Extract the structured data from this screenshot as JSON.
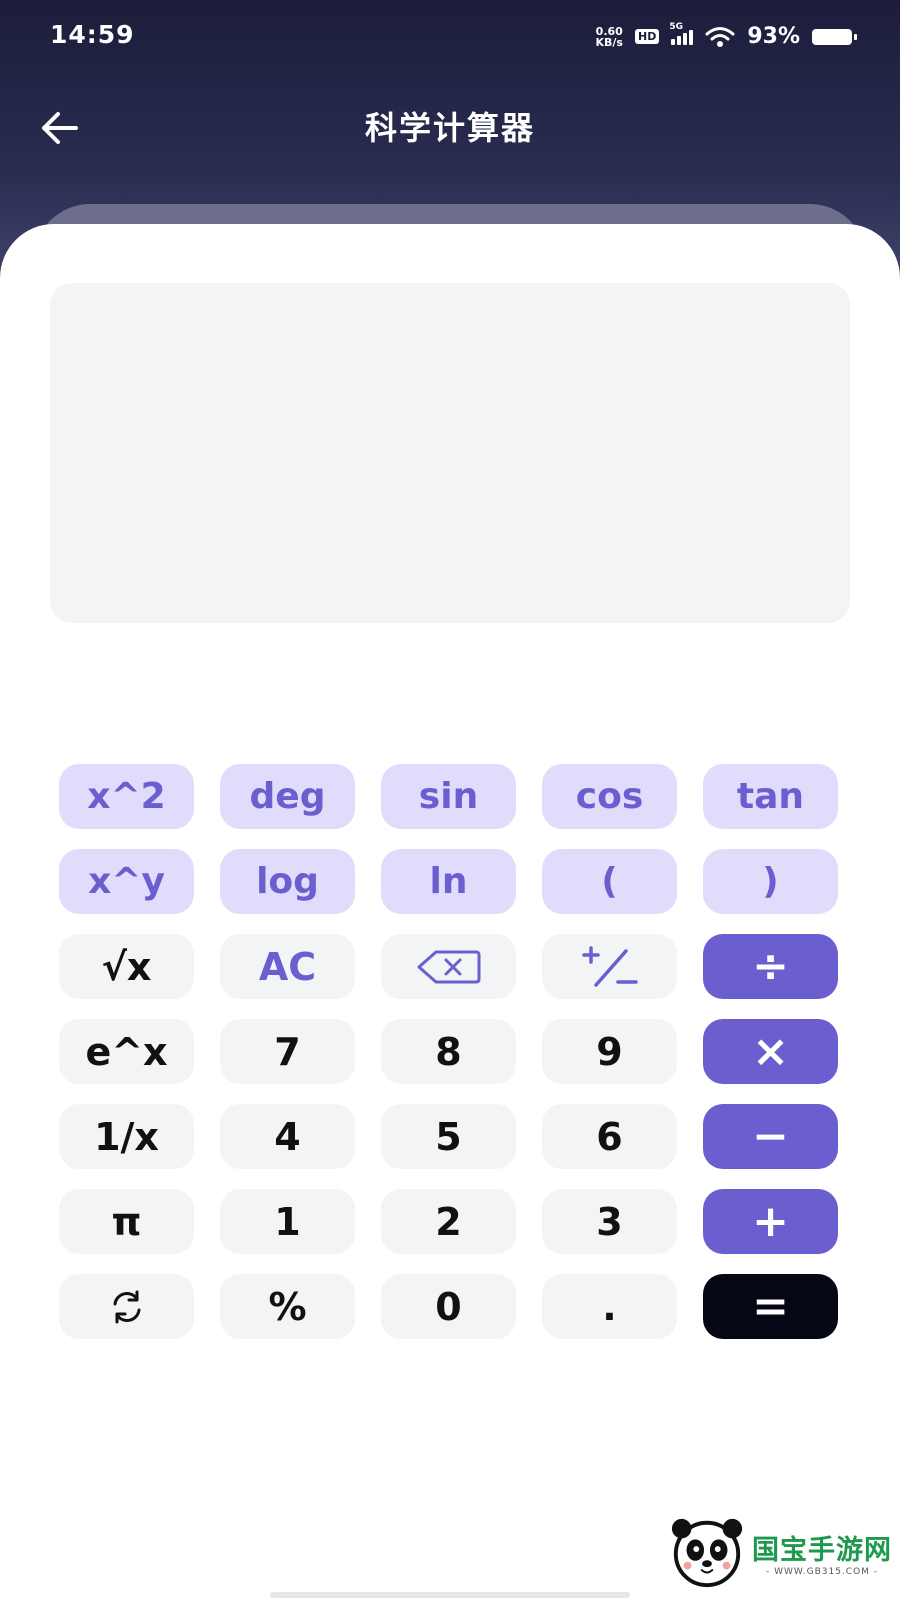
{
  "status_bar": {
    "time": "14:59",
    "net_speed_value": "0.60",
    "net_speed_unit": "KB/s",
    "hd": "HD",
    "network": "5G",
    "battery": "93%"
  },
  "nav": {
    "back_icon": "arrow-left-icon",
    "title": "科学计算器"
  },
  "display": {
    "expression": "",
    "result": ""
  },
  "keypad": {
    "row1": [
      "x^2",
      "deg",
      "sin",
      "cos",
      "tan"
    ],
    "row2": [
      "x^y",
      "log",
      "ln",
      "(",
      ")"
    ],
    "row3": [
      "√x",
      "AC",
      "backspace-icon",
      "plus-minus-icon",
      "÷"
    ],
    "row4": [
      "e^x",
      "7",
      "8",
      "9",
      "×"
    ],
    "row5": [
      "1/x",
      "4",
      "5",
      "6",
      "−"
    ],
    "row6": [
      "π",
      "1",
      "2",
      "3",
      "+"
    ],
    "row7": [
      "rotate-icon",
      "%",
      "0",
      ".",
      "="
    ]
  },
  "colors": {
    "header_dark": "#1b1d3a",
    "function_key_bg": "#e1dcfb",
    "accent_purple": "#6b5fd0",
    "number_key_bg": "#f2f4f6",
    "equals_key_bg": "#050714"
  },
  "watermark": {
    "name": "国宝手游网",
    "url": "- WWW.GB315.COM -"
  }
}
